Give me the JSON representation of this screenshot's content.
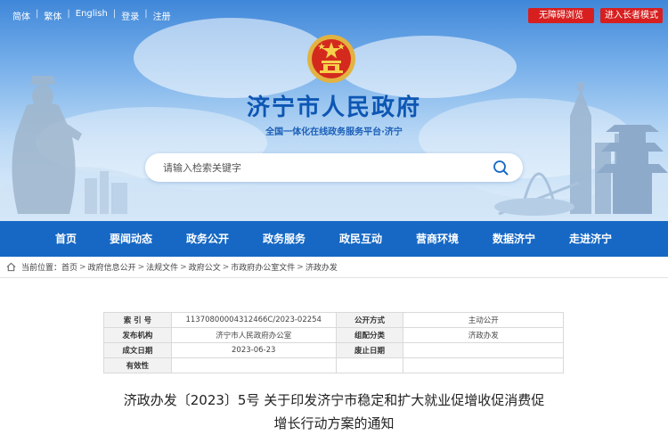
{
  "topbar": {
    "links": [
      "简体",
      "繁体",
      "English",
      "登录",
      "注册"
    ],
    "separator": "|",
    "accessibility": "无障碍浏览",
    "elderly_mode": "进入长者模式"
  },
  "header": {
    "title": "济宁市人民政府",
    "subtitle": "全国一体化在线政务服务平台·济宁"
  },
  "search": {
    "placeholder": "请输入检索关键字"
  },
  "nav": {
    "items": [
      "首页",
      "要闻动态",
      "政务公开",
      "政务服务",
      "政民互动",
      "营商环境",
      "数据济宁",
      "走进济宁"
    ]
  },
  "breadcrumb": {
    "current_label": "当前位置：",
    "items": [
      "首页",
      "政府信息公开",
      "法规文件",
      "政府公文",
      "市政府办公室文件",
      "济政办发"
    ],
    "separator": ">"
  },
  "meta": {
    "rows": [
      [
        "索 引 号",
        "11370800004312466C/2023-02254",
        "公开方式",
        "主动公开"
      ],
      [
        "发布机构",
        "济宁市人民政府办公室",
        "组配分类",
        "济政办发"
      ],
      [
        "成文日期",
        "2023-06-23",
        "废止日期",
        ""
      ],
      [
        "有效性",
        "",
        "",
        ""
      ]
    ]
  },
  "document": {
    "title_line1": "济政办发〔2023〕5号 关于印发济宁市稳定和扩大就业促增收促消费促",
    "title_line2": "增长行动方案的通知"
  },
  "colors": {
    "nav_bg": "#1668c4",
    "title_blue": "#0d56b3",
    "button_red": "#d71f1f"
  },
  "icons": {
    "emblem": "national-emblem-icon",
    "search": "search-icon",
    "home": "home-icon"
  }
}
